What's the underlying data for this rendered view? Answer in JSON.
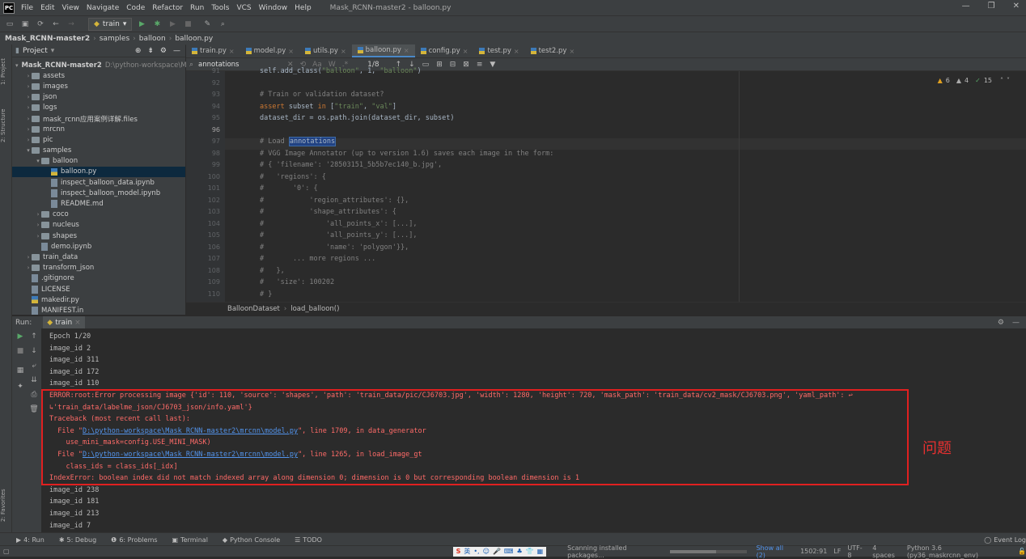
{
  "app": {
    "logo": "PC",
    "title": "Mask_RCNN-master2 - balloon.py",
    "menu": [
      "File",
      "Edit",
      "View",
      "Navigate",
      "Code",
      "Refactor",
      "Run",
      "Tools",
      "VCS",
      "Window",
      "Help"
    ]
  },
  "toolbar": {
    "run_config": "train"
  },
  "breadcrumb": [
    "Mask_RCNN-master2",
    "samples",
    "balloon",
    "balloon.py"
  ],
  "left_tools": {
    "project": "1: Project",
    "structure": "2: Structure",
    "favorites": "2: Favorites"
  },
  "project": {
    "header": "Project",
    "items": [
      {
        "label": "Mask_RCNN-master2",
        "extra": "D:\\python-workspace\\Ma",
        "indent": 0,
        "type": "folder",
        "open": true
      },
      {
        "label": "assets",
        "indent": 1,
        "type": "folder"
      },
      {
        "label": "images",
        "indent": 1,
        "type": "folder"
      },
      {
        "label": "json",
        "indent": 1,
        "type": "folder"
      },
      {
        "label": "logs",
        "indent": 1,
        "type": "folder"
      },
      {
        "label": "mask_rcnn应用案例详解.files",
        "indent": 1,
        "type": "folder"
      },
      {
        "label": "mrcnn",
        "indent": 1,
        "type": "folder"
      },
      {
        "label": "pic",
        "indent": 1,
        "type": "folder"
      },
      {
        "label": "samples",
        "indent": 1,
        "type": "folder",
        "open": true
      },
      {
        "label": "balloon",
        "indent": 2,
        "type": "folder",
        "open": true
      },
      {
        "label": "balloon.py",
        "indent": 3,
        "type": "py",
        "selected": true
      },
      {
        "label": "inspect_balloon_data.ipynb",
        "indent": 3,
        "type": "file"
      },
      {
        "label": "inspect_balloon_model.ipynb",
        "indent": 3,
        "type": "file"
      },
      {
        "label": "README.md",
        "indent": 3,
        "type": "file"
      },
      {
        "label": "coco",
        "indent": 2,
        "type": "folder"
      },
      {
        "label": "nucleus",
        "indent": 2,
        "type": "folder"
      },
      {
        "label": "shapes",
        "indent": 2,
        "type": "folder"
      },
      {
        "label": "demo.ipynb",
        "indent": 2,
        "type": "file"
      },
      {
        "label": "train_data",
        "indent": 1,
        "type": "folder"
      },
      {
        "label": "transform_json",
        "indent": 1,
        "type": "folder"
      },
      {
        "label": ".gitignore",
        "indent": 1,
        "type": "file"
      },
      {
        "label": "LICENSE",
        "indent": 1,
        "type": "file"
      },
      {
        "label": "makedir.py",
        "indent": 1,
        "type": "py"
      },
      {
        "label": "MANIFEST.in",
        "indent": 1,
        "type": "file"
      }
    ]
  },
  "tabs": [
    {
      "label": "train.py"
    },
    {
      "label": "model.py"
    },
    {
      "label": "utils.py"
    },
    {
      "label": "balloon.py",
      "active": true
    },
    {
      "label": "config.py"
    },
    {
      "label": "test.py"
    },
    {
      "label": "test2.py"
    }
  ],
  "find": {
    "query": "annotations",
    "count": "1/8"
  },
  "inspections": {
    "warn": "6",
    "weak": "4",
    "ok": "15"
  },
  "code": {
    "current_line": "96",
    "lines": [
      {
        "n": "91",
        "segs": [
          [
            "plain",
            "self.add_class("
          ],
          [
            "str",
            "\"balloon\""
          ],
          [
            "plain",
            ", 1, "
          ],
          [
            "str",
            "\"balloon\""
          ],
          [
            "plain",
            ")"
          ]
        ]
      },
      {
        "n": "92",
        "segs": []
      },
      {
        "n": "93",
        "segs": [
          [
            "cm",
            "# Train or validation dataset?"
          ]
        ]
      },
      {
        "n": "94",
        "segs": [
          [
            "kw",
            "assert "
          ],
          [
            "plain",
            "subset "
          ],
          [
            "kw",
            "in "
          ],
          [
            "plain",
            "["
          ],
          [
            "str",
            "\"train\""
          ],
          [
            "plain",
            ", "
          ],
          [
            "str",
            "\"val\""
          ],
          [
            "plain",
            "]"
          ]
        ]
      },
      {
        "n": "95",
        "segs": [
          [
            "plain",
            "dataset_dir = os.path.join(dataset_dir, subset)"
          ]
        ]
      },
      {
        "n": "96",
        "segs": []
      },
      {
        "n": "97",
        "segs": [
          [
            "cm",
            "# Load "
          ],
          [
            "hl",
            "annotations"
          ]
        ]
      },
      {
        "n": "98",
        "segs": [
          [
            "cm",
            "# VGG Image Annotator (up to version 1.6) saves each image in the form:"
          ]
        ]
      },
      {
        "n": "99",
        "segs": [
          [
            "cm",
            "# { 'filename': '28503151_5b5b7ec140_b.jpg',"
          ]
        ]
      },
      {
        "n": "100",
        "segs": [
          [
            "cm",
            "#   'regions': {"
          ]
        ]
      },
      {
        "n": "101",
        "segs": [
          [
            "cm",
            "#       '0': {"
          ]
        ]
      },
      {
        "n": "102",
        "segs": [
          [
            "cm",
            "#           'region_attributes': {},"
          ]
        ]
      },
      {
        "n": "103",
        "segs": [
          [
            "cm",
            "#           'shape_attributes': {"
          ]
        ]
      },
      {
        "n": "104",
        "segs": [
          [
            "cm",
            "#               'all_points_x': [...],"
          ]
        ]
      },
      {
        "n": "105",
        "segs": [
          [
            "cm",
            "#               'all_points_y': [...],"
          ]
        ]
      },
      {
        "n": "106",
        "segs": [
          [
            "cm",
            "#               'name': 'polygon'}},"
          ]
        ]
      },
      {
        "n": "107",
        "segs": [
          [
            "cm",
            "#       ... more regions ..."
          ]
        ]
      },
      {
        "n": "108",
        "segs": [
          [
            "cm",
            "#   },"
          ]
        ]
      },
      {
        "n": "109",
        "segs": [
          [
            "cm",
            "#   'size': 100202"
          ]
        ]
      },
      {
        "n": "110",
        "segs": [
          [
            "cm",
            "# }"
          ]
        ]
      }
    ]
  },
  "editor_breadcrumb": [
    "BalloonDataset",
    "load_balloon()"
  ],
  "run": {
    "label": "Run:",
    "tab": "train",
    "lines": [
      {
        "cls": "plain",
        "text": "Epoch 1/20"
      },
      {
        "cls": "plain",
        "text": "image_id 2"
      },
      {
        "cls": "plain",
        "text": "image_id 311"
      },
      {
        "cls": "plain",
        "text": "image_id 172"
      },
      {
        "cls": "plain",
        "text": "image_id 110"
      },
      {
        "cls": "err",
        "text": "ERROR:root:Error processing image {'id': 110, 'source': 'shapes', 'path': 'train_data/pic/CJ6703.jpg', 'width': 1280, 'height': 720, 'mask_path': 'train_data/cv2_mask/CJ6703.png', 'yaml_path': ↩"
      },
      {
        "cls": "err",
        "text": "↳'train_data/labelme_json/CJ6703_json/info.yaml'}"
      },
      {
        "cls": "err",
        "text": "Traceback (most recent call last):"
      },
      {
        "cls": "err",
        "pre": "  File \"",
        "link": "D:\\python-workspace\\Mask_RCNN-master2\\mrcnn\\model.py",
        "post": "\", line 1709, in data_generator"
      },
      {
        "cls": "err",
        "text": "    use_mini_mask=config.USE_MINI_MASK)"
      },
      {
        "cls": "err",
        "pre": "  File \"",
        "link": "D:\\python-workspace\\Mask_RCNN-master2\\mrcnn\\model.py",
        "post": "\", line 1265, in load_image_gt"
      },
      {
        "cls": "err",
        "text": "    class_ids = class_ids[_idx]"
      },
      {
        "cls": "err",
        "text": "IndexError: boolean index did not match indexed array along dimension 0; dimension is 0 but corresponding boolean dimension is 1"
      },
      {
        "cls": "plain",
        "text": "image_id 238"
      },
      {
        "cls": "plain",
        "text": "image_id 181"
      },
      {
        "cls": "plain",
        "text": "image_id 213"
      },
      {
        "cls": "plain",
        "text": "image_id 7"
      }
    ]
  },
  "annotation": "问题",
  "bottom_tabs": [
    "4: Run",
    "5: Debug",
    "6: Problems",
    "Terminal",
    "Python Console",
    "TODO"
  ],
  "event_log": "Event Log",
  "status": {
    "scanning": "Scanning installed packages...",
    "show_all": "Show all (2)",
    "position": "1502:91",
    "line_sep": "LF",
    "encoding": "UTF-8",
    "indent": "4 spaces",
    "interpreter": "Python 3.6 (py36_maskrcnn_env)"
  },
  "ime": "英"
}
